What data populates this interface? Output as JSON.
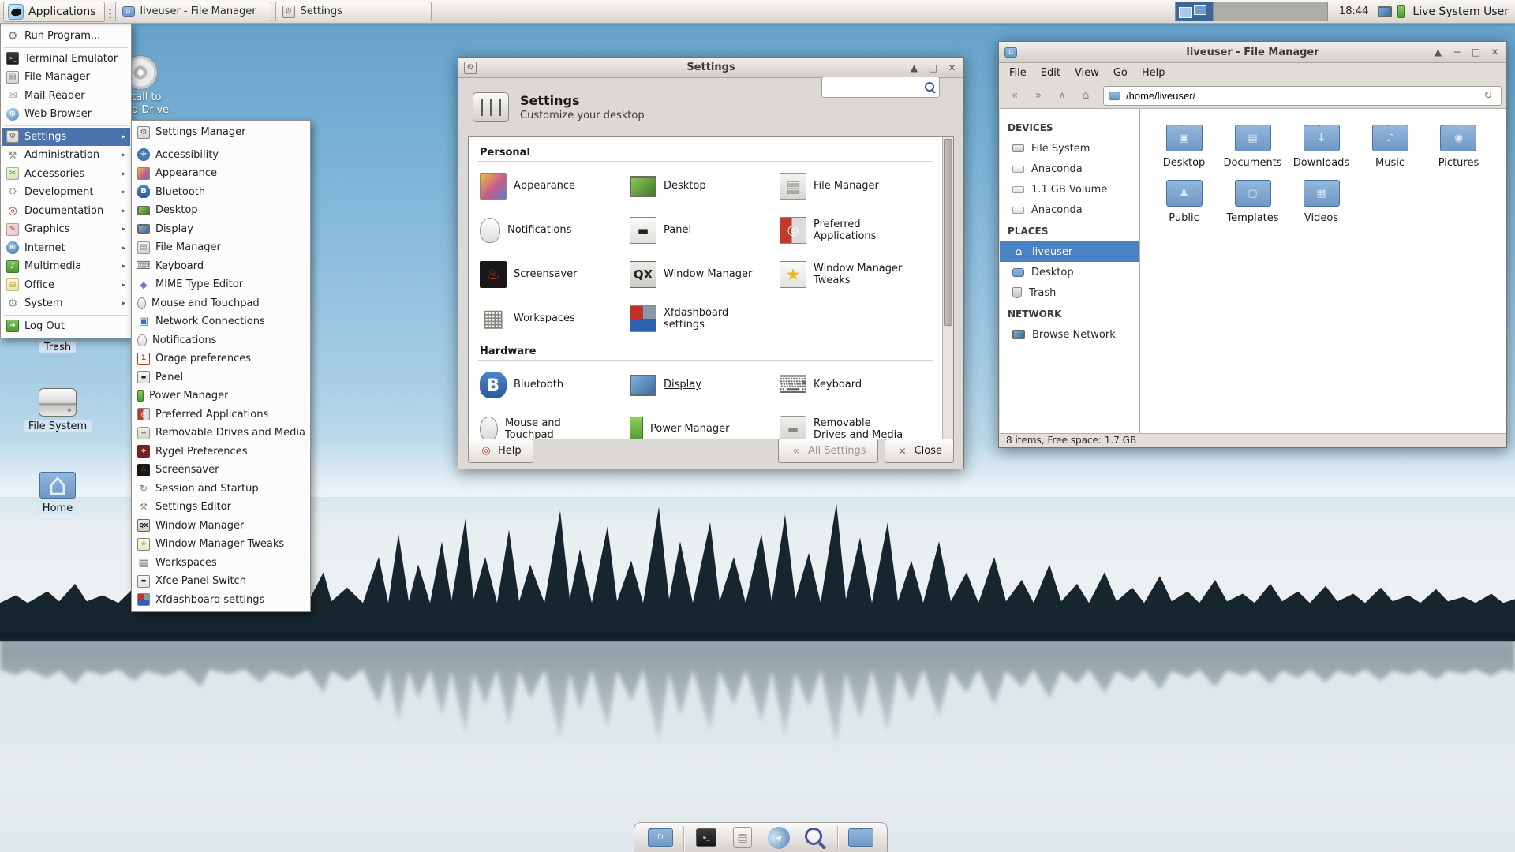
{
  "colors": {
    "menu_highlight": "#4a74ab",
    "sidebar_selection": "#4a80c4",
    "workspace_active": "#3d6696",
    "folder_blue": "#7aa2cc"
  },
  "panel": {
    "applications_label": "Applications",
    "tasks": [
      {
        "title": "liveuser - File Manager",
        "icon": "home-folder-task-icon"
      },
      {
        "title": "Settings",
        "icon": "settings-task-icon"
      }
    ],
    "workspace_count": 4,
    "clock": "18:44",
    "tray_icons": [
      "display-tray-icon",
      "battery-tray-icon"
    ],
    "user_label": "Live System User"
  },
  "applications_menu": {
    "items": [
      {
        "label": "Run Program...",
        "icon": "run-program-icon"
      },
      {
        "separator": true
      },
      {
        "label": "Terminal Emulator",
        "icon": "terminal-icon"
      },
      {
        "label": "File Manager",
        "icon": "file-manager-icon"
      },
      {
        "label": "Mail Reader",
        "icon": "mail-reader-icon"
      },
      {
        "label": "Web Browser",
        "icon": "web-browser-icon"
      },
      {
        "separator": true
      },
      {
        "label": "Settings",
        "icon": "settings-manager-icon",
        "submenu": true,
        "highlighted": true
      },
      {
        "label": "Administration",
        "icon": "administration-icon",
        "submenu": true
      },
      {
        "label": "Accessories",
        "icon": "accessories-icon",
        "submenu": true
      },
      {
        "label": "Development",
        "icon": "development-icon",
        "submenu": true
      },
      {
        "label": "Documentation",
        "icon": "documentation-icon",
        "submenu": true
      },
      {
        "label": "Graphics",
        "icon": "graphics-icon",
        "submenu": true
      },
      {
        "label": "Internet",
        "icon": "internet-icon",
        "submenu": true
      },
      {
        "label": "Multimedia",
        "icon": "multimedia-icon",
        "submenu": true
      },
      {
        "label": "Office",
        "icon": "office-icon",
        "submenu": true
      },
      {
        "label": "System",
        "icon": "system-icon",
        "submenu": true
      },
      {
        "separator": true
      },
      {
        "label": "Log Out",
        "icon": "log-out-icon"
      }
    ]
  },
  "settings_submenu": {
    "items": [
      {
        "label": "Settings Manager",
        "icon": "settings-manager-icon"
      },
      {
        "separator": true
      },
      {
        "label": "Accessibility",
        "icon": "accessibility-icon"
      },
      {
        "label": "Appearance",
        "icon": "appearance-icon"
      },
      {
        "label": "Bluetooth",
        "icon": "bluetooth-icon"
      },
      {
        "label": "Desktop",
        "icon": "desktop-settings-icon"
      },
      {
        "label": "Display",
        "icon": "display-icon"
      },
      {
        "label": "File Manager",
        "icon": "file-manager-icon"
      },
      {
        "label": "Keyboard",
        "icon": "keyboard-icon"
      },
      {
        "label": "MIME Type Editor",
        "icon": "mime-type-icon"
      },
      {
        "label": "Mouse and Touchpad",
        "icon": "mouse-touchpad-icon"
      },
      {
        "label": "Network Connections",
        "icon": "network-connections-icon"
      },
      {
        "label": "Notifications",
        "icon": "notifications-icon"
      },
      {
        "label": "Orage preferences",
        "icon": "orage-icon"
      },
      {
        "label": "Panel",
        "icon": "panel-icon"
      },
      {
        "label": "Power Manager",
        "icon": "power-manager-icon"
      },
      {
        "label": "Preferred Applications",
        "icon": "preferred-applications-icon"
      },
      {
        "label": "Removable Drives and Media",
        "icon": "removable-drives-icon"
      },
      {
        "label": "Rygel Preferences",
        "icon": "rygel-icon"
      },
      {
        "label": "Screensaver",
        "icon": "screensaver-icon"
      },
      {
        "label": "Session and Startup",
        "icon": "session-startup-icon"
      },
      {
        "label": "Settings Editor",
        "icon": "settings-editor-icon"
      },
      {
        "label": "Window Manager",
        "icon": "window-manager-icon"
      },
      {
        "label": "Window Manager Tweaks",
        "icon": "wm-tweaks-icon"
      },
      {
        "label": "Workspaces",
        "icon": "workspaces-icon"
      },
      {
        "label": "Xfce Panel Switch",
        "icon": "xfce-panel-switch-icon"
      },
      {
        "label": "Xfdashboard settings",
        "icon": "xfdashboard-icon"
      }
    ]
  },
  "desktop": {
    "icons": [
      {
        "label": "Trash",
        "icon": "trash-desktop-icon"
      },
      {
        "label": "File System",
        "icon": "filesystem-desktop-icon"
      },
      {
        "label": "Home",
        "icon": "home-desktop-icon"
      }
    ],
    "partial_icon": {
      "icon": "optical-drive-icon",
      "label_lines": [
        "tall to",
        "d Drive"
      ]
    }
  },
  "settings_window": {
    "window_title": "Settings",
    "header": {
      "title": "Settings",
      "subtitle": "Customize your desktop"
    },
    "search_value": "",
    "sections": [
      {
        "title": "Personal",
        "items": [
          {
            "label": "Appearance",
            "icon": "appearance-icon"
          },
          {
            "label": "Desktop",
            "icon": "desktop-settings-icon"
          },
          {
            "label": "File Manager",
            "icon": "file-manager-icon"
          },
          {
            "label": "Notifications",
            "icon": "notifications-icon"
          },
          {
            "label": "Panel",
            "icon": "panel-icon"
          },
          {
            "label": "Preferred Applications",
            "icon": "preferred-applications-icon"
          },
          {
            "label": "Screensaver",
            "icon": "screensaver-icon"
          },
          {
            "label": "Window Manager",
            "icon": "window-manager-icon"
          },
          {
            "label": "Window Manager Tweaks",
            "icon": "wm-tweaks-icon"
          },
          {
            "label": "Workspaces",
            "icon": "workspaces-icon"
          },
          {
            "label": "Xfdashboard settings",
            "icon": "xfdashboard-icon"
          }
        ]
      },
      {
        "title": "Hardware",
        "items": [
          {
            "label": "Bluetooth",
            "icon": "bluetooth-icon"
          },
          {
            "label": "Display",
            "icon": "display-icon",
            "hovered": true
          },
          {
            "label": "Keyboard",
            "icon": "keyboard-icon"
          },
          {
            "label": "Mouse and Touchpad",
            "icon": "mouse-touchpad-icon"
          },
          {
            "label": "Power Manager",
            "icon": "power-manager-icon"
          },
          {
            "label": "Removable Drives and Media",
            "icon": "removable-drives-icon"
          }
        ]
      }
    ],
    "buttons": [
      {
        "label": "Help",
        "icon": "help-icon",
        "disabled": false
      },
      {
        "label": "All Settings",
        "icon": "all-settings-icon",
        "disabled": true
      },
      {
        "label": "Close",
        "icon": "close-icon",
        "disabled": false
      }
    ]
  },
  "file_manager": {
    "window_title": "liveuser - File Manager",
    "menubar": [
      "File",
      "Edit",
      "View",
      "Go",
      "Help"
    ],
    "path": "/home/liveuser/",
    "sidebar": [
      {
        "title": "DEVICES",
        "items": [
          {
            "label": "File System",
            "icon": "hdd-icon"
          },
          {
            "label": "Anaconda",
            "icon": "volume-icon"
          },
          {
            "label": "1.1 GB Volume",
            "icon": "volume-icon"
          },
          {
            "label": "Anaconda",
            "icon": "volume-icon"
          }
        ]
      },
      {
        "title": "PLACES",
        "items": [
          {
            "label": "liveuser",
            "icon": "home-icon",
            "selected": true
          },
          {
            "label": "Desktop",
            "icon": "desktop-folder-small-icon"
          },
          {
            "label": "Trash",
            "icon": "trash-small-icon"
          }
        ]
      },
      {
        "title": "NETWORK",
        "items": [
          {
            "label": "Browse Network",
            "icon": "browse-network-icon"
          }
        ]
      }
    ],
    "files": [
      {
        "name": "Desktop",
        "icon": "folder-desktop-icon"
      },
      {
        "name": "Documents",
        "icon": "folder-documents-icon"
      },
      {
        "name": "Downloads",
        "icon": "folder-downloads-icon"
      },
      {
        "name": "Music",
        "icon": "folder-music-icon"
      },
      {
        "name": "Pictures",
        "icon": "folder-pictures-icon"
      },
      {
        "name": "Public",
        "icon": "folder-public-icon"
      },
      {
        "name": "Templates",
        "icon": "folder-templates-icon"
      },
      {
        "name": "Videos",
        "icon": "folder-videos-icon"
      }
    ],
    "statusbar": "8 items, Free space: 1.7 GB"
  },
  "dock": {
    "items": [
      {
        "icon": "dock-desktop-folder-icon"
      },
      {
        "separator": true
      },
      {
        "icon": "dock-terminal-icon"
      },
      {
        "icon": "dock-file-manager-icon"
      },
      {
        "icon": "dock-web-browser-icon"
      },
      {
        "icon": "dock-search-icon"
      },
      {
        "separator": true
      },
      {
        "icon": "dock-folder-icon"
      }
    ]
  }
}
